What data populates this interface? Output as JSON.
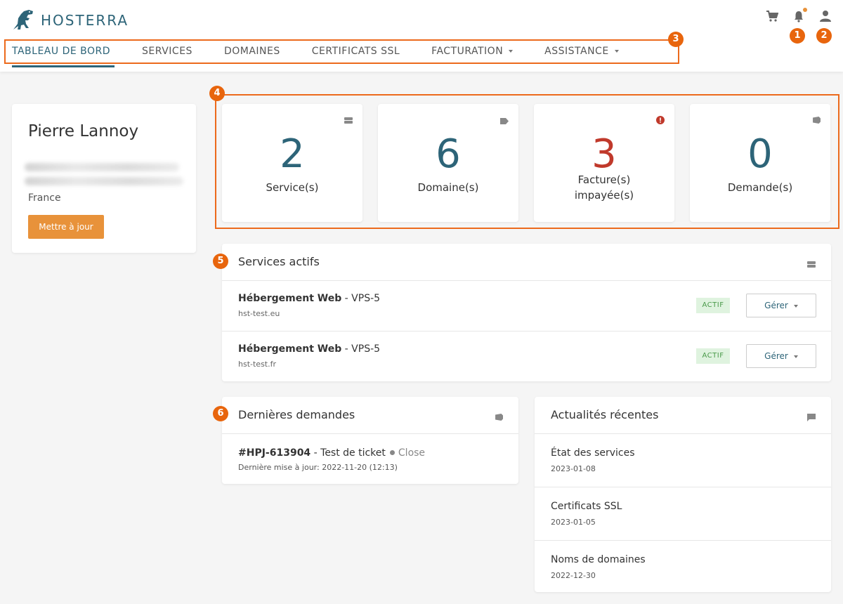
{
  "brand": {
    "name": "HOSTERRA",
    "color": "#2d6478",
    "accent": "#e8923a"
  },
  "nav": {
    "items": [
      {
        "label": "TABLEAU DE BORD",
        "active": true
      },
      {
        "label": "SERVICES"
      },
      {
        "label": "DOMAINES"
      },
      {
        "label": "CERTIFICATS SSL"
      },
      {
        "label": "FACTURATION",
        "dropdown": true
      },
      {
        "label": "ASSISTANCE",
        "dropdown": true
      }
    ]
  },
  "header_icons": [
    "cart-icon",
    "bell-icon",
    "user-icon"
  ],
  "annotations": [
    "1",
    "2",
    "3",
    "4",
    "5",
    "6"
  ],
  "profile": {
    "name": "Pierre Lannoy",
    "country": "France",
    "update_button": "Mettre à jour"
  },
  "stats": [
    {
      "value": "2",
      "label": "Service(s)",
      "icon": "server-icon"
    },
    {
      "value": "6",
      "label": "Domaine(s)",
      "icon": "tag-icon"
    },
    {
      "value": "3",
      "label": "Facture(s) impayée(s)",
      "icon": "alert-circle-icon",
      "color": "#c0392b"
    },
    {
      "value": "0",
      "label": "Demande(s)",
      "icon": "ticket-icon"
    }
  ],
  "active_services": {
    "title": "Services actifs",
    "items": [
      {
        "name": "Hébergement Web",
        "plan": " - VPS-5",
        "domain": "hst-test.eu",
        "status": "ACTIF",
        "action": "Gérer"
      },
      {
        "name": "Hébergement Web",
        "plan": " - VPS-5",
        "domain": "hst-test.fr",
        "status": "ACTIF",
        "action": "Gérer"
      }
    ]
  },
  "recent_tickets": {
    "title": "Dernières demandes",
    "items": [
      {
        "id": "#HPJ-613904",
        "subject": " - Test de ticket",
        "status": "Close",
        "updated": "Dernière mise à jour: 2022-11-20 (12:13)"
      }
    ]
  },
  "news": {
    "title": "Actualités récentes",
    "items": [
      {
        "title": "État des services",
        "date": "2023-01-08"
      },
      {
        "title": "Certificats SSL",
        "date": "2023-01-05"
      },
      {
        "title": "Noms de domaines",
        "date": "2022-12-30"
      }
    ]
  }
}
